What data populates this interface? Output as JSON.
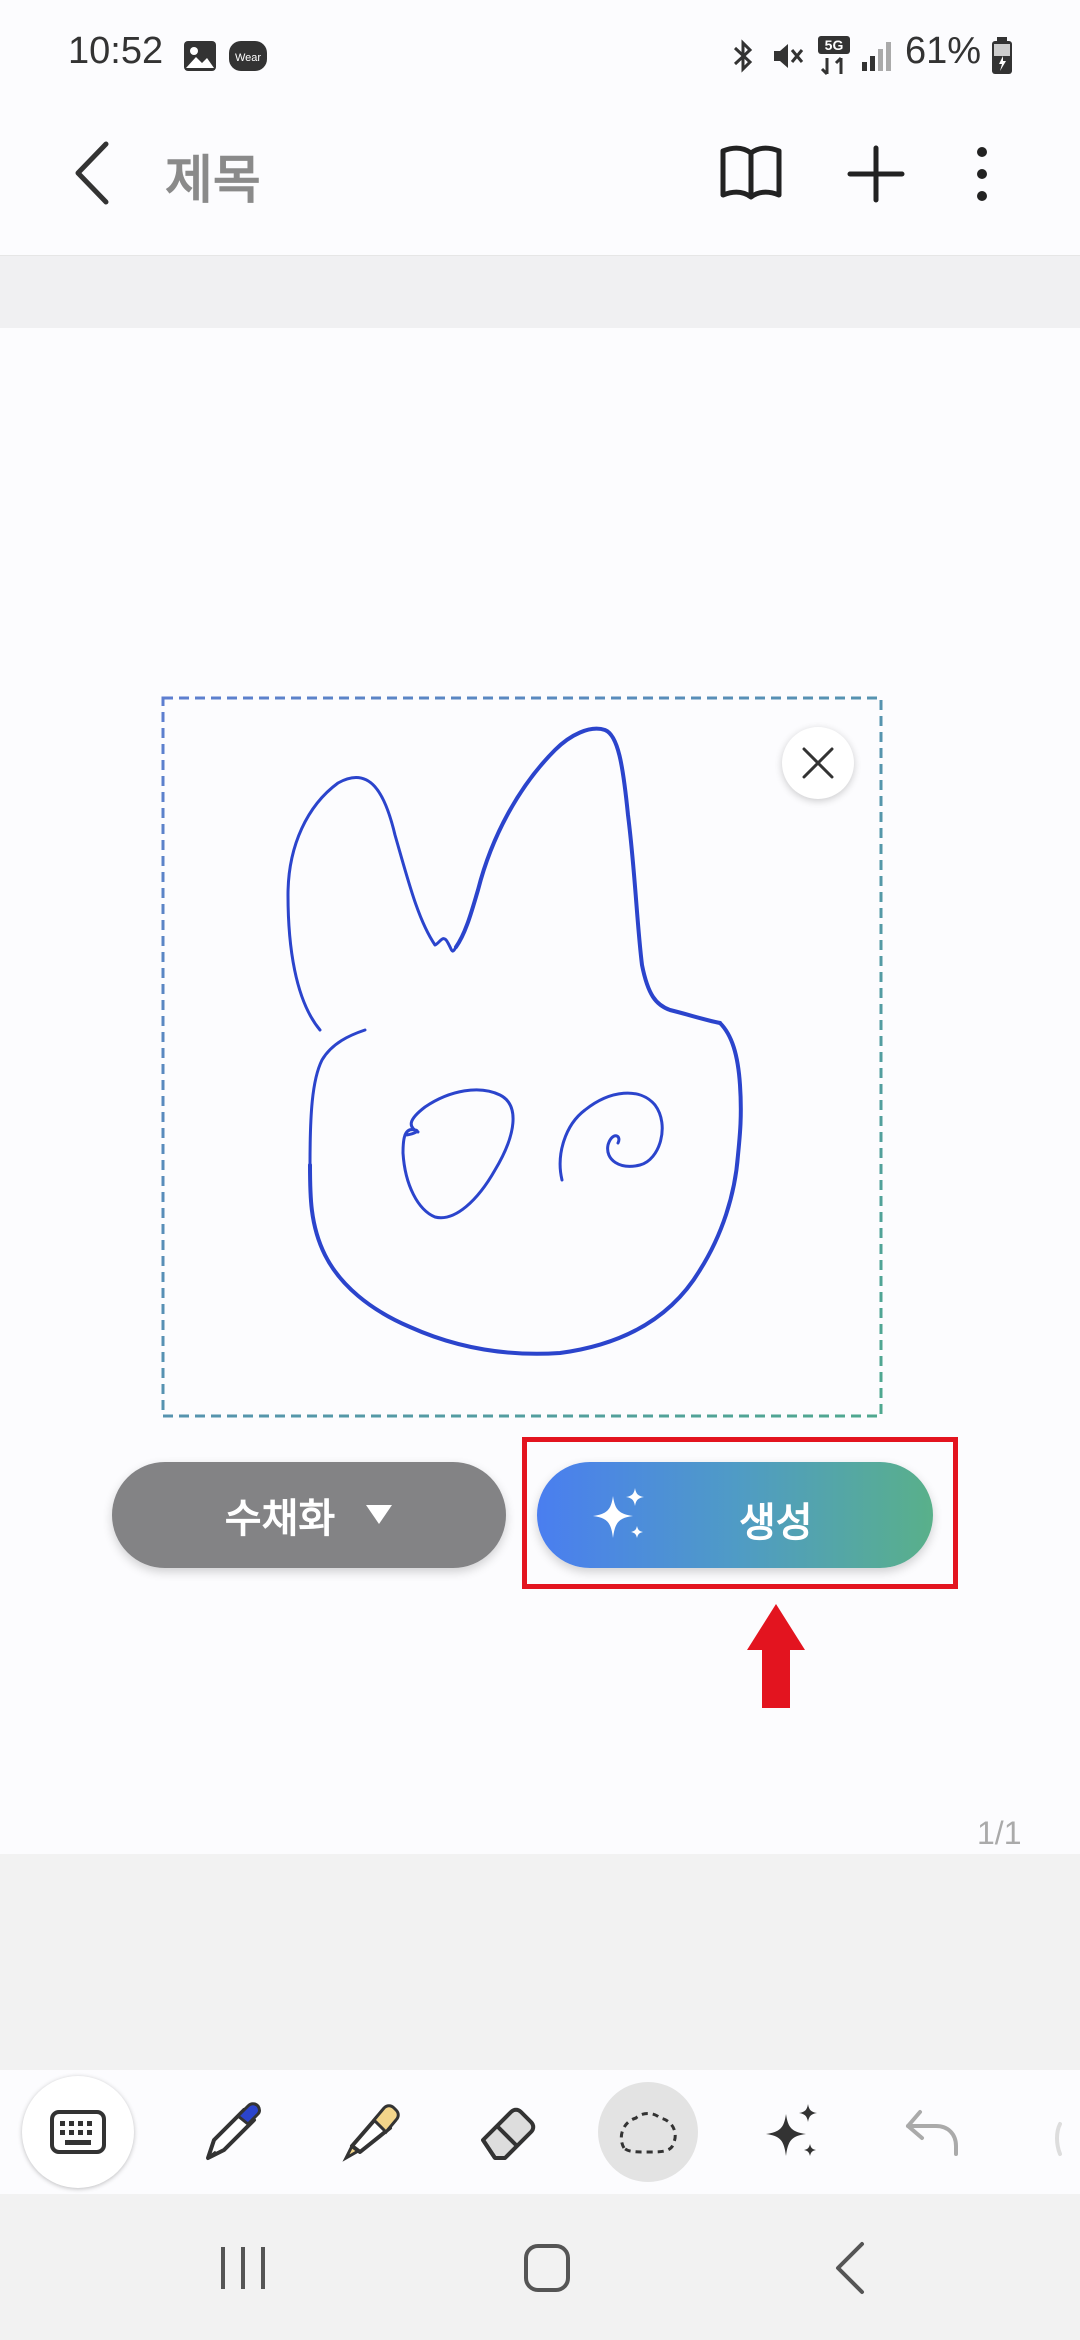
{
  "status_bar": {
    "time": "10:52",
    "battery": "61%",
    "icons": [
      "image-icon",
      "wear-icon",
      "bluetooth-icon",
      "mute-icon",
      "5g-icon",
      "signal-icon",
      "battery-icon"
    ]
  },
  "app_bar": {
    "title": "제목",
    "icons": [
      "back-icon",
      "book-icon",
      "add-icon",
      "more-icon"
    ]
  },
  "canvas": {
    "page_indicator": "1/1"
  },
  "actions": {
    "style_label": "수채화",
    "generate_label": "생성"
  },
  "toolbar": {
    "tools": [
      "keyboard-icon",
      "pen-icon",
      "highlighter-icon",
      "eraser-icon",
      "lasso-icon",
      "sparkle-icon",
      "undo-icon"
    ]
  },
  "colors": {
    "stroke": "#2b44cc",
    "highlight": "#e3141f",
    "gradient_start": "#4a7ef0",
    "gradient_end": "#59b08a"
  }
}
